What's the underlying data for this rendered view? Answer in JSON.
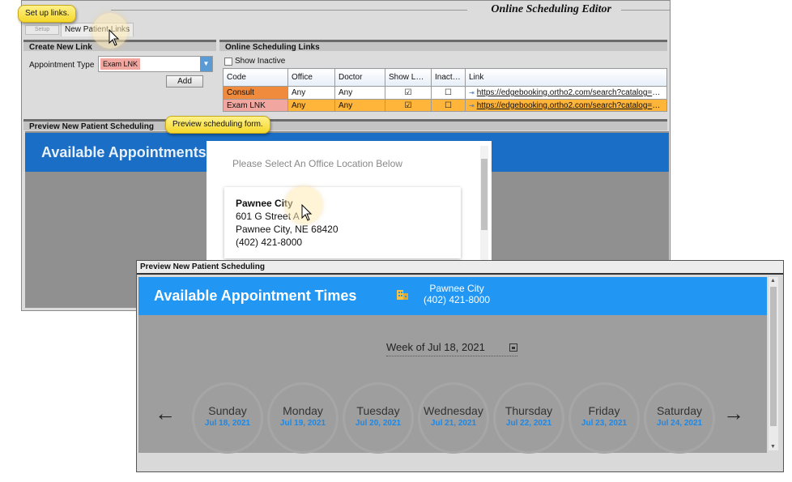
{
  "editor": {
    "title": "Online Scheduling Editor",
    "tabs": [
      "Setup",
      "New Patient Links"
    ]
  },
  "create_link": {
    "header": "Create New Link",
    "appointment_type_label": "Appointment Type",
    "appointment_type_value": "Exam LNK",
    "add_label": "Add"
  },
  "links": {
    "header": "Online Scheduling Links",
    "show_inactive_label": "Show Inactive",
    "columns": [
      "Code",
      "Office",
      "Doctor",
      "Show Logo",
      "Inactive",
      "Link"
    ],
    "rows": [
      {
        "code": "Consult",
        "office": "Any",
        "doctor": "Any",
        "show_logo": true,
        "inactive": false,
        "link": "https://edgebooking.ortho2.com/search?catalog=0..."
      },
      {
        "code": "Exam LNK",
        "office": "Any",
        "doctor": "Any",
        "show_logo": true,
        "inactive": false,
        "link": "https://edgebooking.ortho2.com/search?catalog=0..."
      }
    ]
  },
  "preview_back": {
    "header": "Preview New Patient Scheduling",
    "banner_title": "Available Appointments",
    "select_prompt": "Please Select An Office Location Below",
    "office": {
      "name": "Pawnee City",
      "street": "601 G Street A",
      "citystate": "Pawnee City, NE 68420",
      "phone": "(402) 421-8000"
    }
  },
  "callouts": {
    "setup_links": "Set up links.",
    "preview_form": "Preview scheduling form."
  },
  "preview_front": {
    "header": "Preview New Patient Scheduling",
    "banner_title": "Available Appointment Times",
    "office_name": "Pawnee City",
    "office_phone": "(402) 421-8000",
    "week_label": "Week of Jul 18, 2021",
    "prev_arrow": "←",
    "next_arrow": "→",
    "days": [
      {
        "name": "Sunday",
        "date": "Jul 18, 2021"
      },
      {
        "name": "Monday",
        "date": "Jul 19, 2021"
      },
      {
        "name": "Tuesday",
        "date": "Jul 20, 2021"
      },
      {
        "name": "Wednesday",
        "date": "Jul 21, 2021"
      },
      {
        "name": "Thursday",
        "date": "Jul 22, 2021"
      },
      {
        "name": "Friday",
        "date": "Jul 23, 2021"
      },
      {
        "name": "Saturday",
        "date": "Jul 24, 2021"
      }
    ]
  },
  "colors": {
    "banner": "#2196f3",
    "date_text": "#1e88e5",
    "callout": "#f5d72a",
    "consult": "#f08a3c",
    "selected_row": "#ffb43a"
  }
}
